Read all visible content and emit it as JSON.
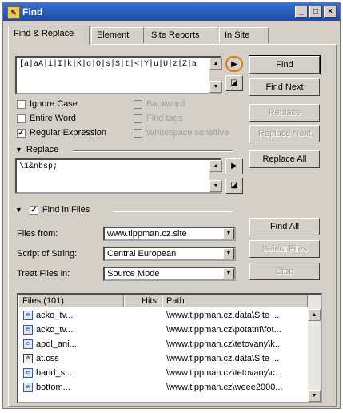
{
  "window": {
    "title": "Find",
    "minimize": "_",
    "maximize": "□",
    "close": "×"
  },
  "tabs": [
    {
      "label": "Find & Replace"
    },
    {
      "label": "Element"
    },
    {
      "label": "Site Reports"
    },
    {
      "label": "In Site"
    }
  ],
  "find": {
    "pattern": "[a|aA|i|I|k|K|o|O|s|S|t|<|Y|u|U|z|Z|a",
    "ignore_case": "Ignore Case",
    "entire_word": "Entire Word",
    "regular_expression": "Regular Expression",
    "opt_a": "Backward",
    "opt_b": "Find tags",
    "opt_c": "Whitespace sensitive"
  },
  "replace": {
    "section_label": "Replace",
    "value": "\\1&nbsp;"
  },
  "find_in_files": {
    "section_label": "Find in Files",
    "files_from_label": "Files from:",
    "files_from_value": "www.tippman.cz.site",
    "script_label": "Script of String:",
    "script_value": "Central European",
    "treat_label": "Treat Files in:",
    "treat_value": "Source Mode"
  },
  "buttons": {
    "find": "Find",
    "find_next": "Find Next",
    "replace": "Replace",
    "replace_next": "Replace Next",
    "replace_all": "Replace All",
    "find_all": "Find All",
    "btn_a": "Select Files",
    "btn_b": "Stop"
  },
  "results": {
    "col_files": "Files (101)",
    "col_hits": "Hits",
    "col_path": "Path",
    "rows": [
      {
        "name": "acko_tv...",
        "path": "\\www.tippman.cz.data\\Site ..."
      },
      {
        "name": "acko_tv...",
        "path": "\\www.tippman.cz\\potatnf\\fot..."
      },
      {
        "name": "apol_ani...",
        "path": "\\www.tippman.cz\\tetovany\\k..."
      },
      {
        "name": "at.css",
        "path": "\\www.tippman.cz.data\\Site ..."
      },
      {
        "name": "band_s...",
        "path": "\\www.tippman.cz\\tetovany\\c..."
      },
      {
        "name": "bottom...",
        "path": "\\www.tippman.cz\\weee2000..."
      }
    ]
  },
  "colors": {
    "title_bar": "#1c4aa8",
    "dialog": "#d4d0c8",
    "highlight_ring": "#e07a10"
  }
}
